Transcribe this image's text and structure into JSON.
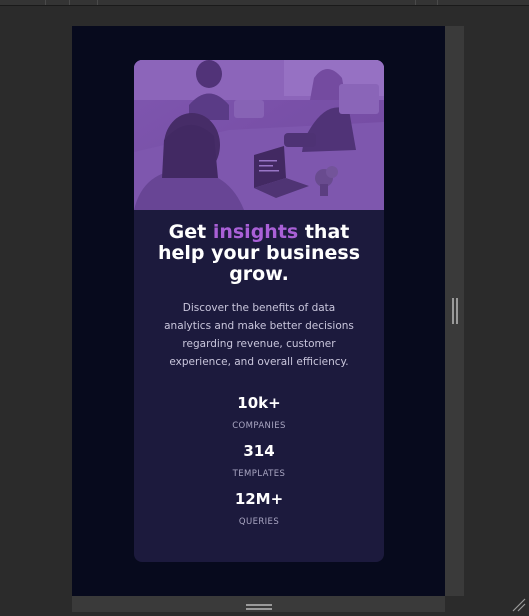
{
  "headline": {
    "before": "Get ",
    "accent": "insights",
    "after": " that help your business grow."
  },
  "description": "Discover the benefits of data analytics and make better decisions regarding revenue, customer experience, and overall efficiency.",
  "stats": [
    {
      "value": "10k+",
      "label": "COMPANIES"
    },
    {
      "value": "314",
      "label": "TEMPLATES"
    },
    {
      "value": "12M+",
      "label": "QUERIES"
    }
  ],
  "colors": {
    "page_background": "#070a1d",
    "card_background": "#1c1a3d",
    "accent": "#a960d7",
    "image_overlay": "#8a4ec6"
  },
  "icons": {
    "hero_image": "team-meeting-photo",
    "resize_handle_vertical": "grip-vertical-icon",
    "resize_handle_horizontal": "grip-horizontal-icon",
    "corner_grip": "resize-corner-icon"
  }
}
